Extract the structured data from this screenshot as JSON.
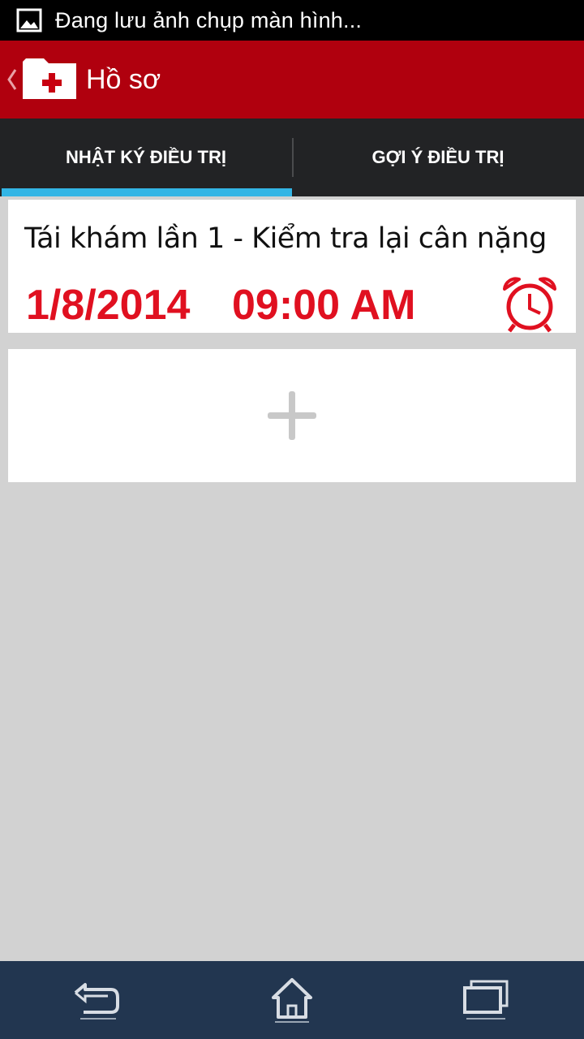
{
  "status_bar": {
    "text": "Đang lưu ảnh chụp màn hình...",
    "icon": "image-icon"
  },
  "action_bar": {
    "title": "Hồ sơ",
    "back_icon": "chevron-left-icon",
    "app_icon": "medical-folder-icon",
    "color": "#b0000e"
  },
  "tabs": [
    {
      "label": "NHẬT KÝ ĐIỀU TRỊ",
      "active": true
    },
    {
      "label": "GỢI Ý ĐIỀU TRỊ",
      "active": false
    }
  ],
  "tab_indicator_color": "#33b5e5",
  "appointments": [
    {
      "title": "Tái khám lần 1 - Kiểm tra lại cân nặng",
      "date": "1/8/2014",
      "time": "09:00 AM",
      "icon": "alarm-clock-icon",
      "accent_color": "#e01020"
    }
  ],
  "add_button": {
    "icon": "plus-icon"
  },
  "nav_bar": {
    "buttons": [
      {
        "icon": "back-icon"
      },
      {
        "icon": "home-icon"
      },
      {
        "icon": "recent-apps-icon"
      }
    ],
    "color": "#223650"
  }
}
